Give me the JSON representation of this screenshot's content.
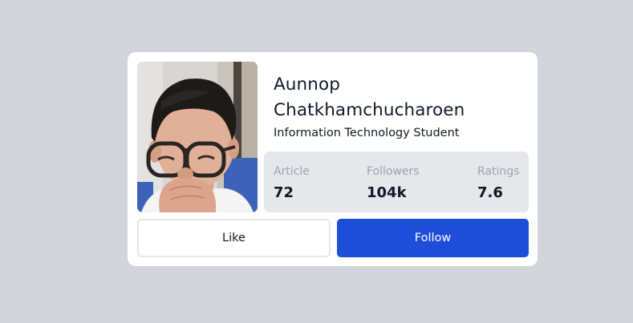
{
  "profile": {
    "first_name": "Aunnop",
    "last_name": "Chatkhamchucharoen",
    "role": "Information Technology Student"
  },
  "stats": [
    {
      "label": "Article",
      "value": "72"
    },
    {
      "label": "Followers",
      "value": "104k"
    },
    {
      "label": "Ratings",
      "value": "7.6"
    }
  ],
  "actions": {
    "like_label": "Like",
    "follow_label": "Follow"
  },
  "colors": {
    "page_background": "#d1d5db",
    "card_background": "#ffffff",
    "stats_background": "#e5e7eb",
    "primary_button": "#1d4ed8"
  }
}
